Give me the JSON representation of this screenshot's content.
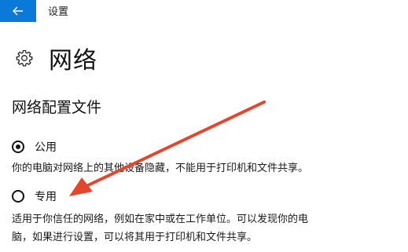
{
  "window": {
    "title": "设置",
    "back_icon": "back-arrow-icon"
  },
  "page": {
    "title": "网络",
    "icon": "gear-icon"
  },
  "network_profile": {
    "section_title": "网络配置文件",
    "options": [
      {
        "label": "公用",
        "selected": true,
        "description": "你的电脑对网络上的其他设备隐藏，不能用于打印机和文件共享。"
      },
      {
        "label": "专用",
        "selected": false,
        "description_line1": "适用于你信任的网络，例如在家中或在工作单位。可以发现你的电",
        "description_line2": "脑，如果进行设置，可以将其用于打印机和文件共享。"
      }
    ]
  },
  "colors": {
    "accent": "#0a79d8",
    "annotation_arrow": "#e2462c"
  }
}
